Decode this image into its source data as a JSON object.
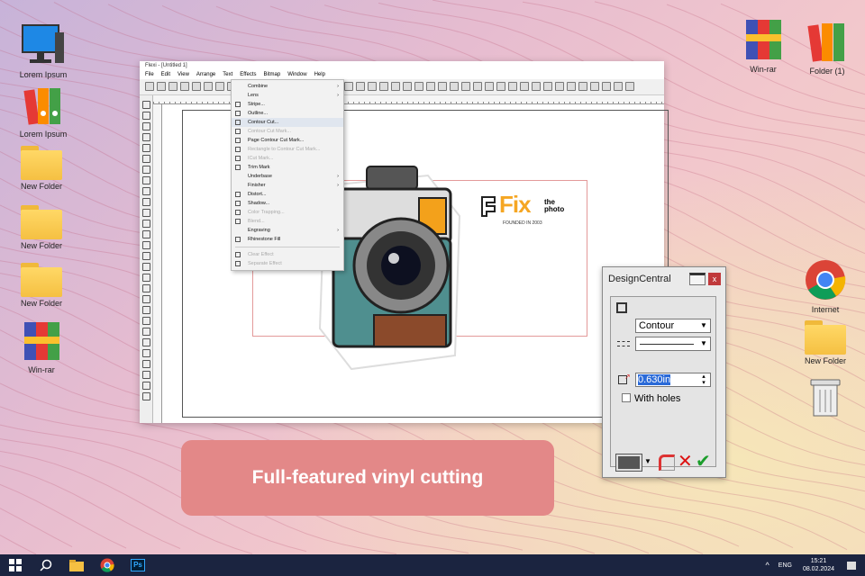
{
  "desktop": {
    "left_icons": [
      "Lorem Ipsum",
      "Lorem Ipsum",
      "New Folder",
      "New Folder",
      "New Folder",
      "Win-rar"
    ],
    "right_icons": [
      "Win-rar",
      "Folder (1)",
      "Internet",
      "New Folder"
    ]
  },
  "app": {
    "title": "Flexi - [Untitled 1]",
    "menus": [
      "File",
      "Edit",
      "View",
      "Arrange",
      "Text",
      "Effects",
      "Bitmap",
      "Window",
      "Help"
    ],
    "effects_menu": [
      {
        "label": "Combine",
        "sub": true
      },
      {
        "label": "Lens",
        "sub": true
      },
      {
        "label": "Stripe..."
      },
      {
        "label": "Outline..."
      },
      {
        "label": "Contour Cut...",
        "highlighted": true
      },
      {
        "label": "Contour Cut Mark...",
        "disabled": true
      },
      {
        "label": "Page Contour Cut Mark..."
      },
      {
        "label": "Rectangle to Contour Cut Mark...",
        "disabled": true
      },
      {
        "label": "ICut Mark...",
        "disabled": true
      },
      {
        "label": "Trim Mark"
      },
      {
        "label": "Underbase",
        "sub": true
      },
      {
        "label": "Finisher",
        "sub": true
      },
      {
        "label": "Distort..."
      },
      {
        "label": "Shadow..."
      },
      {
        "label": "Color Trapping...",
        "disabled": true
      },
      {
        "label": "Blend...",
        "disabled": true
      },
      {
        "label": "Engraving",
        "sub": true
      },
      {
        "label": "Rhinestone Fill"
      },
      {
        "label": "Clear Effect",
        "disabled": true
      },
      {
        "label": "Separate Effect",
        "disabled": true
      }
    ],
    "submenu_arrow": "›"
  },
  "logo": {
    "brand": "Fix",
    "tag1": "the",
    "tag2": "photo",
    "founded": "FOUNDED IN 2003"
  },
  "design_central": {
    "title": "DesignCentral",
    "close": "x",
    "type": "Contour",
    "offset": "0.630in",
    "with_holes": "With holes"
  },
  "banner": {
    "text": "Full-featured vinyl cutting"
  },
  "taskbar": {
    "lang": "ENG",
    "time": "15:21",
    "date": "08.02.2024",
    "tray_arrow": "^"
  },
  "colors": {
    "banner": "#e38888",
    "taskbar": "#1b2440",
    "logo_orange": "#f5a623"
  }
}
